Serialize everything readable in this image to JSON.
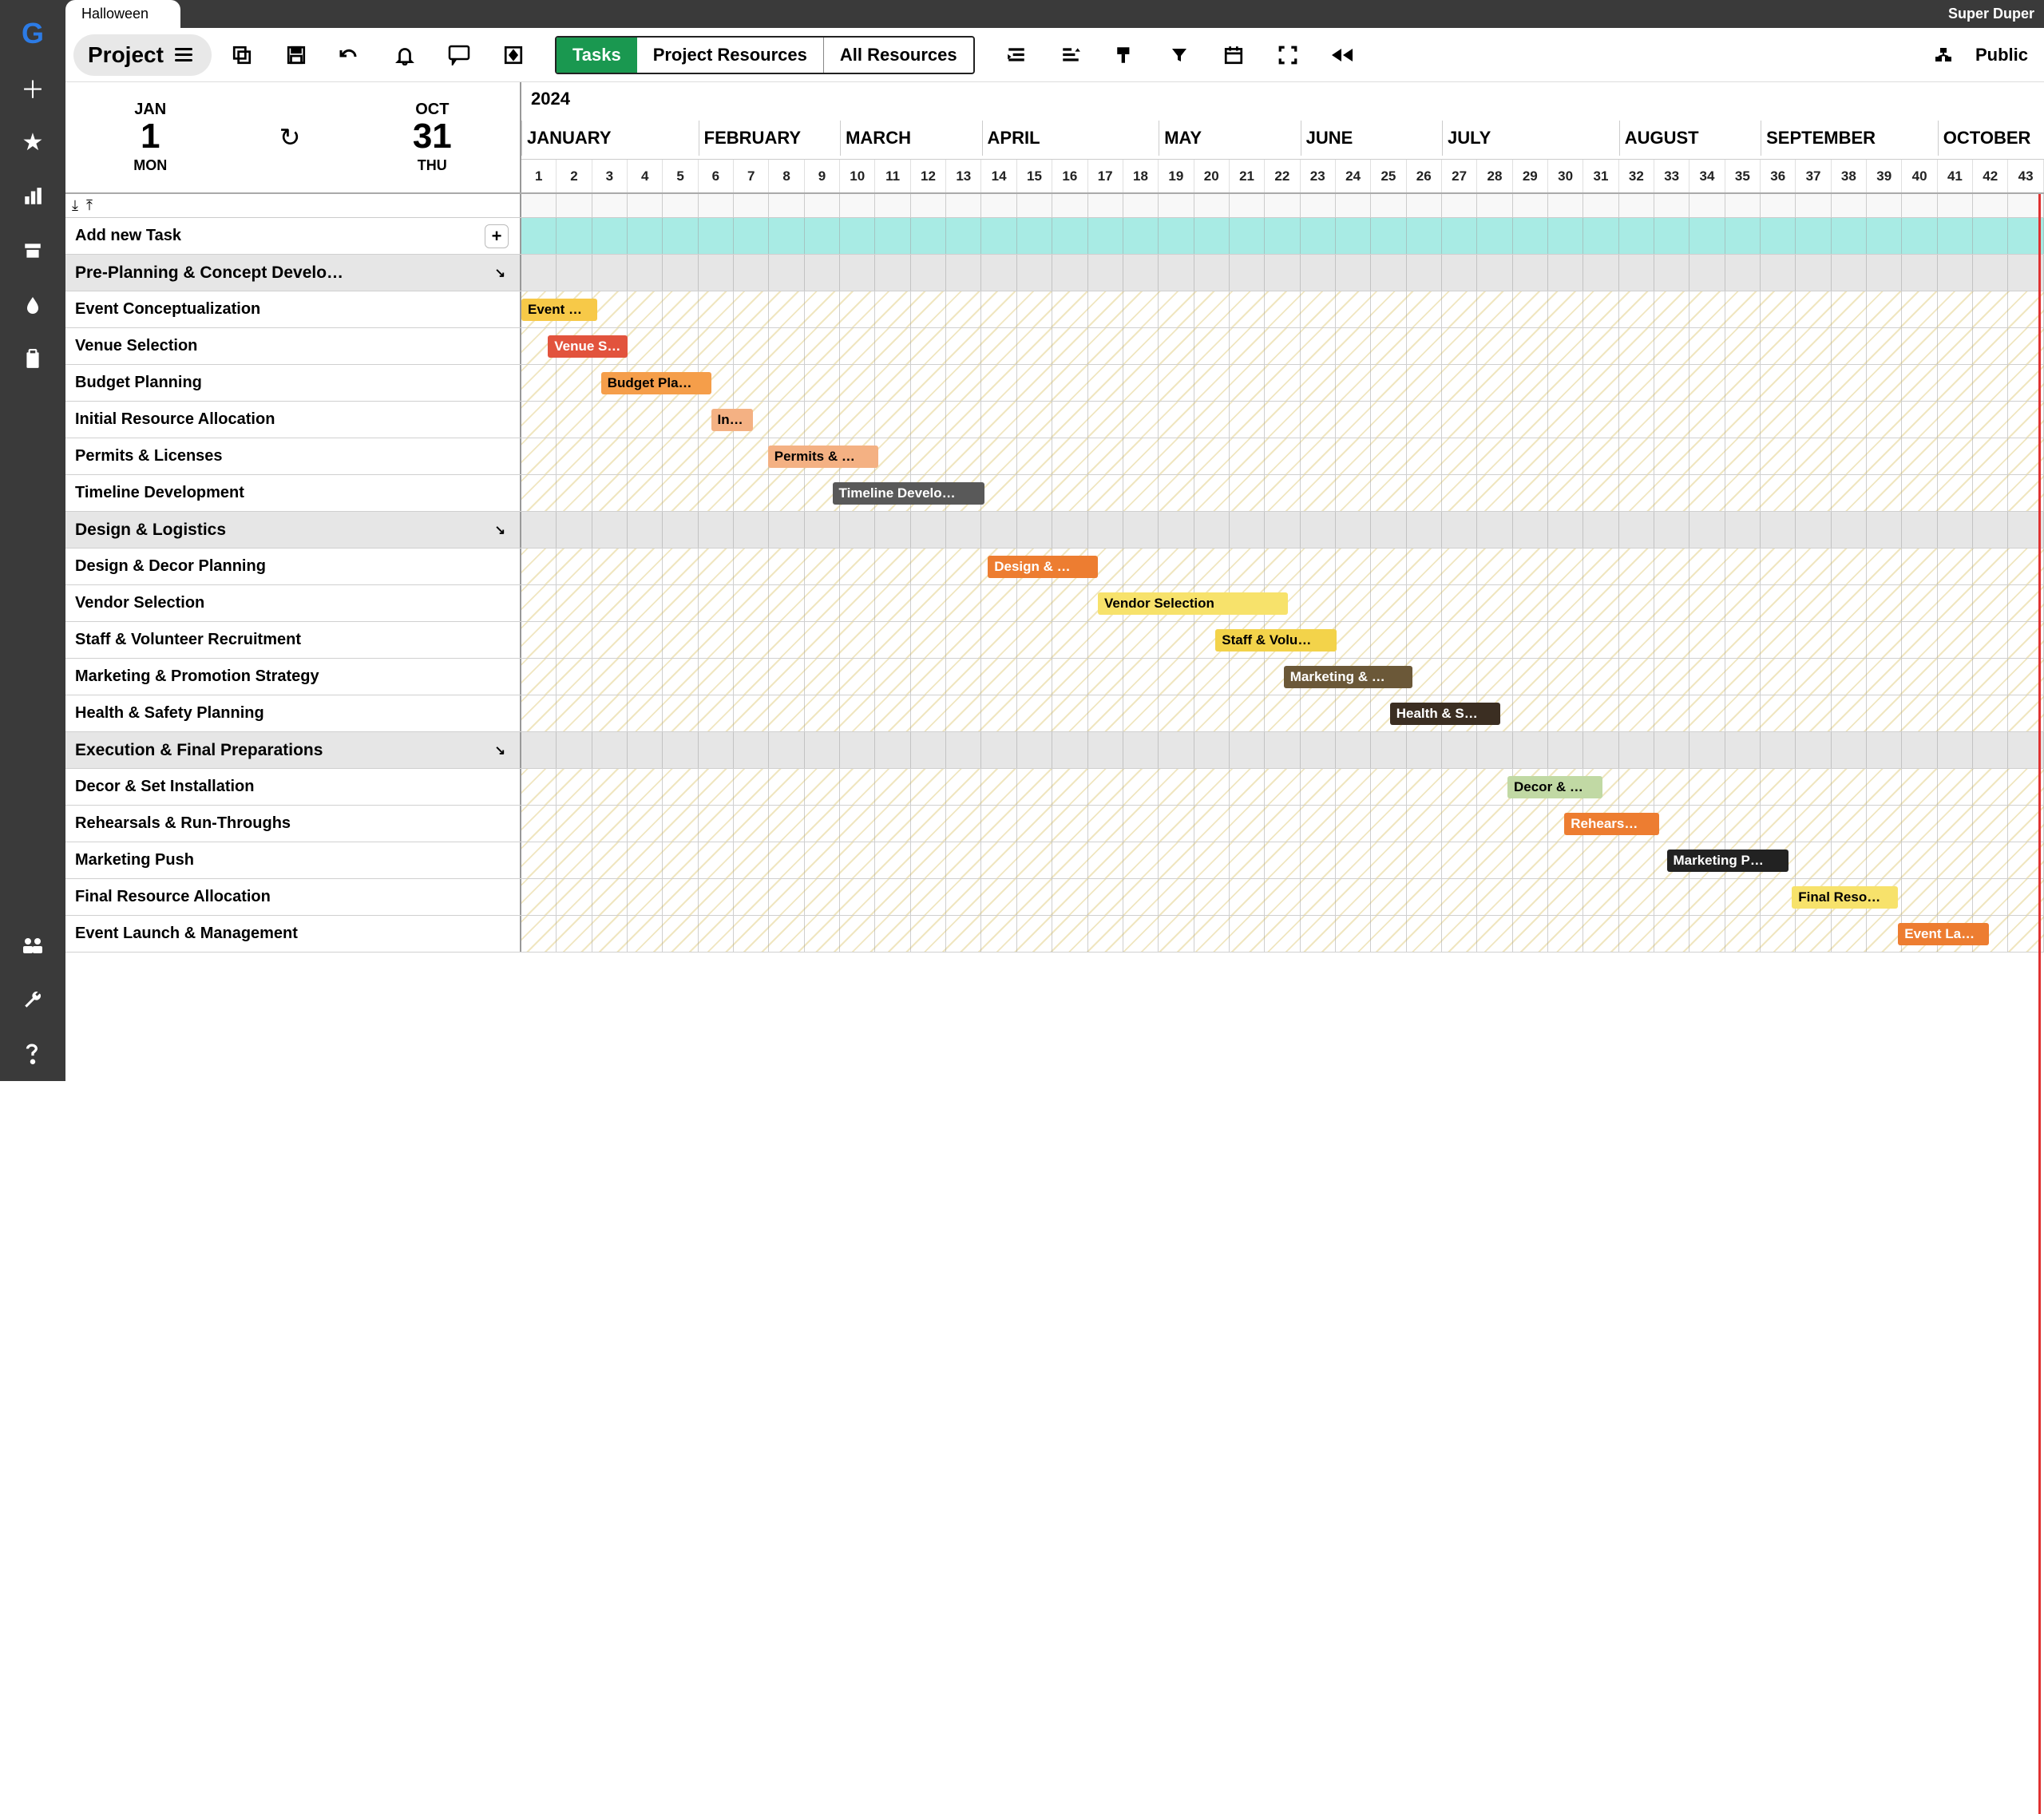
{
  "app": {
    "tab_title": "Halloween",
    "account_name": "Super Duper"
  },
  "project_button": {
    "label": "Project"
  },
  "view_tabs": {
    "tasks": "Tasks",
    "project_resources": "Project Resources",
    "all_resources": "All Resources"
  },
  "public_label": "Public",
  "dates": {
    "start": {
      "month": "JAN",
      "day": "1",
      "dow": "MON"
    },
    "end": {
      "month": "OCT",
      "day": "31",
      "dow": "THU"
    }
  },
  "timeline": {
    "year": "2024",
    "months": [
      "JANUARY",
      "FEBRUARY",
      "MARCH",
      "APRIL",
      "MAY",
      "JUNE",
      "JULY",
      "AUGUST",
      "SEPTEMBER",
      "OCTOBER"
    ],
    "month_week_counts": [
      5,
      4,
      4,
      5,
      4,
      4,
      5,
      4,
      5,
      3
    ],
    "week_count": 43,
    "today_week": 40
  },
  "rows": [
    {
      "type": "addnew",
      "label": "Add new Task"
    },
    {
      "type": "group",
      "label": "Pre-Planning & Concept Develo…"
    },
    {
      "type": "task",
      "label": "Event Conceptualization",
      "bar": {
        "start": 0,
        "span": 2.0,
        "color": "#f7c948",
        "text": "Event …"
      }
    },
    {
      "type": "task",
      "label": "Venue Selection",
      "bar": {
        "start": 0.7,
        "span": 2.1,
        "color": "#e2533d",
        "text": "Venue S…",
        "textcolor": "#fff"
      }
    },
    {
      "type": "task",
      "label": "Budget Planning",
      "bar": {
        "start": 2.1,
        "span": 2.9,
        "color": "#f59e4a",
        "text": "Budget Pla…"
      }
    },
    {
      "type": "task",
      "label": "Initial Resource Allocation",
      "bar": {
        "start": 5.0,
        "span": 1.1,
        "color": "#f4b183",
        "text": "In…"
      }
    },
    {
      "type": "task",
      "label": "Permits & Licenses",
      "bar": {
        "start": 6.5,
        "span": 2.9,
        "color": "#f4b183",
        "text": "Permits & …"
      }
    },
    {
      "type": "task",
      "label": "Timeline Development",
      "bar": {
        "start": 8.2,
        "span": 4.0,
        "color": "#595959",
        "text": "Timeline Develo…",
        "textcolor": "#fff"
      }
    },
    {
      "type": "group",
      "label": "Design & Logistics"
    },
    {
      "type": "task",
      "label": "Design & Decor Planning",
      "bar": {
        "start": 12.3,
        "span": 2.9,
        "color": "#ed7d31",
        "text": "Design & …",
        "textcolor": "#fff"
      }
    },
    {
      "type": "task",
      "label": "Vendor Selection",
      "bar": {
        "start": 15.2,
        "span": 5.0,
        "color": "#f7e26b",
        "text": "Vendor Selection"
      }
    },
    {
      "type": "task",
      "label": "Staff & Volunteer Recruitment",
      "bar": {
        "start": 18.3,
        "span": 3.2,
        "color": "#f3d34a",
        "text": "Staff & Volu…"
      }
    },
    {
      "type": "task",
      "label": "Marketing & Promotion Strategy",
      "bar": {
        "start": 20.1,
        "span": 3.4,
        "color": "#6b5838",
        "text": "Marketing & …",
        "textcolor": "#fff"
      }
    },
    {
      "type": "task",
      "label": "Health & Safety Planning",
      "bar": {
        "start": 22.9,
        "span": 2.9,
        "color": "#3b2e22",
        "text": "Health & S…",
        "textcolor": "#fff"
      }
    },
    {
      "type": "group",
      "label": "Execution & Final Preparations"
    },
    {
      "type": "task",
      "label": "Decor & Set Installation",
      "bar": {
        "start": 26.0,
        "span": 2.5,
        "color": "#c1d9a4",
        "text": "Decor & …"
      }
    },
    {
      "type": "task",
      "label": "Rehearsals & Run-Throughs",
      "bar": {
        "start": 27.5,
        "span": 2.5,
        "color": "#ed7d31",
        "text": "Rehears…",
        "textcolor": "#fff"
      }
    },
    {
      "type": "task",
      "label": "Marketing Push",
      "bar": {
        "start": 30.2,
        "span": 3.2,
        "color": "#222",
        "text": "Marketing P…",
        "textcolor": "#fff"
      }
    },
    {
      "type": "task",
      "label": "Final Resource Allocation",
      "bar": {
        "start": 33.5,
        "span": 2.8,
        "color": "#f7e26b",
        "text": "Final Reso…"
      }
    },
    {
      "type": "task",
      "label": "Event Launch & Management",
      "bar": {
        "start": 36.3,
        "span": 2.4,
        "color": "#ed7d31",
        "text": "Event La…",
        "textcolor": "#fff"
      }
    }
  ]
}
